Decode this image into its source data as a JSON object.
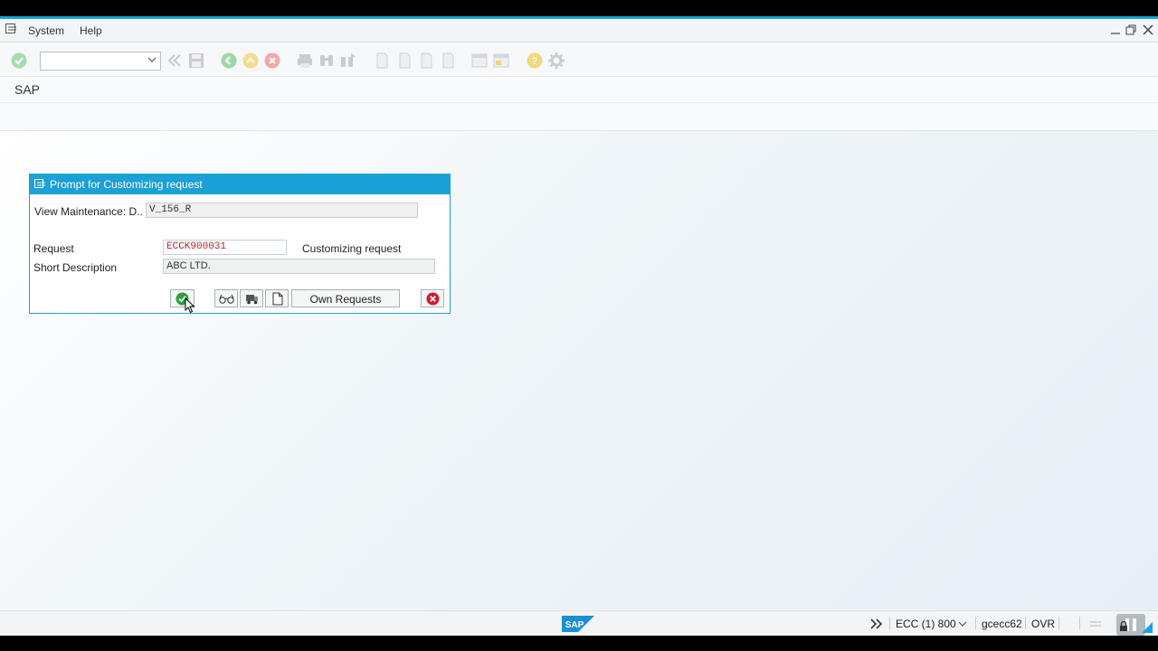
{
  "menubar": {
    "items": [
      "System",
      "Help"
    ]
  },
  "toolbar": {
    "command_field_value": ""
  },
  "title": "SAP",
  "dialog": {
    "title": "Prompt for Customizing request",
    "view_label": "View Maintenance: D..",
    "view_value": "V_156_R",
    "request_label": "Request",
    "request_value": "ECCK900031",
    "request_type": "Customizing request",
    "short_desc_label": "Short Description",
    "short_desc_value": "ABC LTD.",
    "own_requests_label": "Own Requests"
  },
  "status": {
    "system": "ECC (1) 800",
    "server": "gcecc62",
    "mode": "OVR"
  },
  "colors": {
    "accent": "#1ba0d7",
    "confirm": "#2e9e3f",
    "cancel": "#cc1f2f",
    "request_text": "#b5282b"
  }
}
